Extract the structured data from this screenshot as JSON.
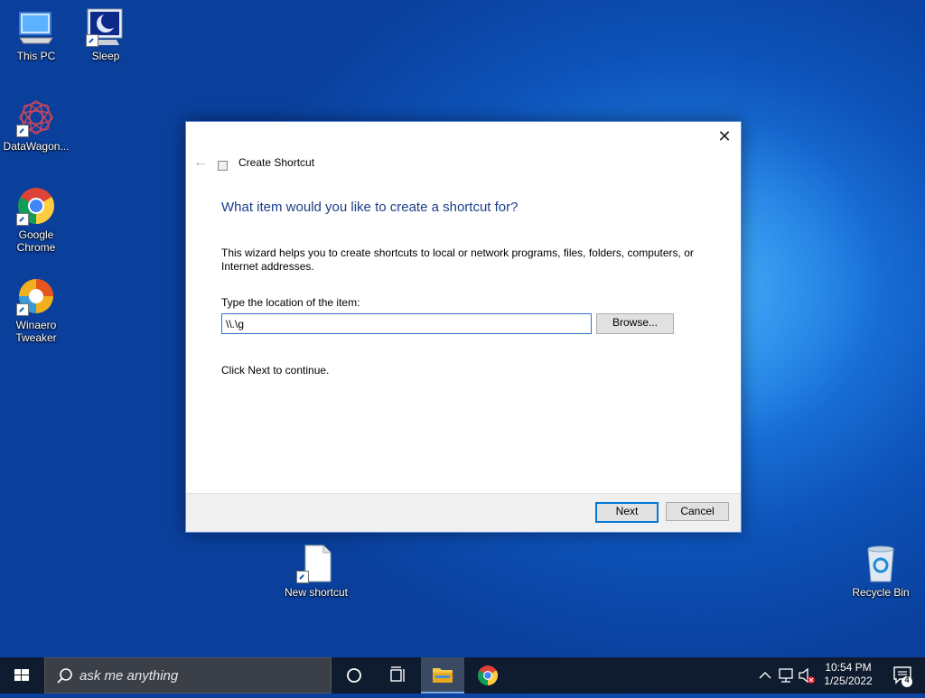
{
  "desktop": {
    "icons": [
      {
        "label": "This PC"
      },
      {
        "label": "Sleep"
      },
      {
        "label": "DataWagon..."
      },
      {
        "label": "Google\nChrome"
      },
      {
        "label": "Winaero\nTweaker"
      },
      {
        "label": "New shortcut"
      },
      {
        "label": "Recycle Bin"
      }
    ]
  },
  "dialog": {
    "window_title": "Create Shortcut",
    "heading": "What item would you like to create a shortcut for?",
    "description": "This wizard helps you to create shortcuts to local or network programs, files, folders, computers, or Internet addresses.",
    "location_label": "Type the location of the item:",
    "location_value": "\\\\.\\g",
    "browse_label": "Browse...",
    "hint": "Click Next to continue.",
    "next_label": "Next",
    "cancel_label": "Cancel"
  },
  "taskbar": {
    "search_placeholder": "ask me anything",
    "time": "10:54 PM",
    "date": "1/25/2022",
    "notification_count": "4"
  },
  "colors": {
    "accent": "#0078d7",
    "heading": "#1b3f8b",
    "taskbar": "#0f1b2e"
  }
}
